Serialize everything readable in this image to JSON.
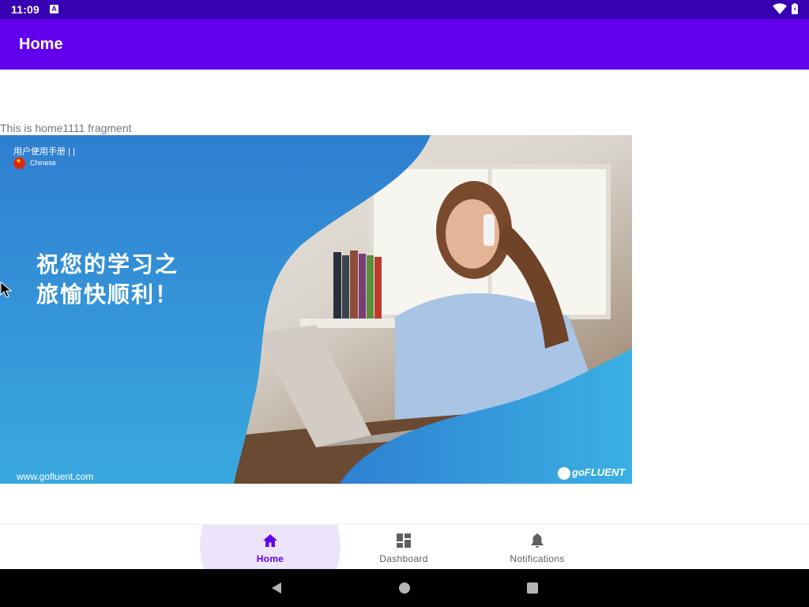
{
  "status_bar": {
    "time": "11:09",
    "notification_glyph": "A",
    "icons": [
      "a-notification-icon",
      "wifi-icon",
      "battery-icon"
    ]
  },
  "app_bar": {
    "title": "Home"
  },
  "content": {
    "fragment_text": "This is home1111 fragment",
    "banner": {
      "manual_label": "用户使用手册 | |",
      "language": "Chinese",
      "headline": "祝您的学习之\n旅愉快顺利！",
      "url": "www.gofluent.com",
      "logo_text": "goFLUENT"
    }
  },
  "bottom_nav": {
    "items": [
      {
        "label": "Home",
        "icon": "home-icon",
        "selected": true
      },
      {
        "label": "Dashboard",
        "icon": "dashboard-icon",
        "selected": false
      },
      {
        "label": "Notifications",
        "icon": "bell-icon",
        "selected": false
      }
    ]
  },
  "system_nav": {
    "icons": [
      "back-icon",
      "home-circle-icon",
      "recents-icon"
    ]
  },
  "colors": {
    "status_bar": "#3700b3",
    "primary": "#6200ee",
    "banner_blue": "#2b8bd3",
    "nav_selected_bg": "#ece4fb",
    "nav_inactive": "#5f5f5f"
  }
}
